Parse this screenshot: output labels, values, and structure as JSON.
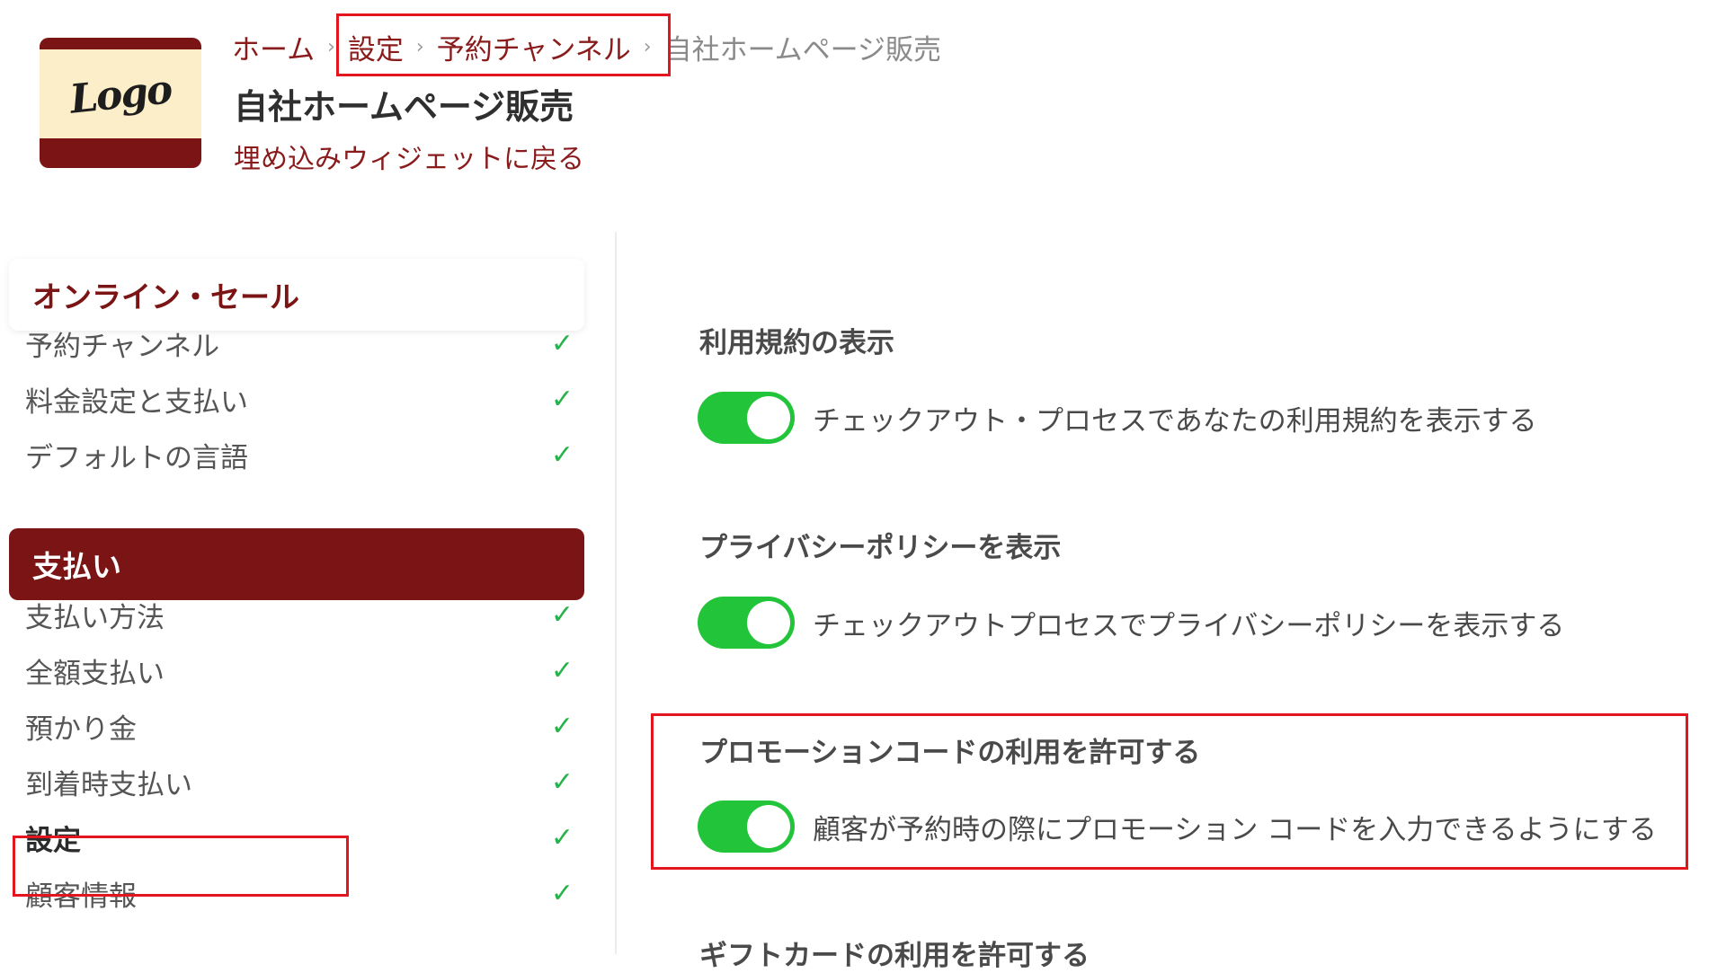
{
  "header": {
    "logo_text": "Logo",
    "breadcrumb": [
      "ホーム",
      "設定",
      "予約チャンネル",
      "自社ホームページ販売"
    ],
    "separator": "›",
    "title": "自社ホームページ販売",
    "back_link": "埋め込みウィジェットに戻る"
  },
  "sidebar": {
    "section1": "オンライン・セール",
    "section1_items": [
      "予約チャンネル",
      "料金設定と支払い",
      "デフォルトの言語"
    ],
    "section2": "支払い",
    "section2_items": [
      "支払い方法",
      "全額支払い",
      "預かり金",
      "到着時支払い",
      "設定",
      "顧客情報"
    ],
    "check_icon": "✓"
  },
  "main": {
    "options": [
      {
        "title": "利用規約の表示",
        "label": "チェックアウト・プロセスであなたの利用規約を表示する",
        "enabled": true
      },
      {
        "title": "プライバシーポリシーを表示",
        "label": "チェックアウトプロセスでプライバシーポリシーを表示する",
        "enabled": true
      },
      {
        "title": "プロモーションコードの利用を許可する",
        "label": "顧客が予約時の際にプロモーション コードを入力できるようにする",
        "enabled": true
      },
      {
        "title": "ギフトカードの利用を許可する"
      }
    ]
  },
  "colors": {
    "brand": "#7b1515",
    "toggle_on": "#22c43a",
    "check": "#26b34a",
    "highlight": "#e3161f"
  }
}
